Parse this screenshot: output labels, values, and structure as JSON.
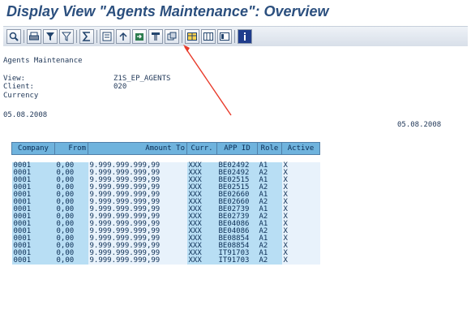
{
  "window_title": "Display View \"Agents Maintenance\": Overview",
  "toolbar": {
    "buttons": [
      "back-icon",
      "print-icon",
      "filter-icon",
      "filter-options-icon",
      "sum-icon",
      "details-icon",
      "sort-icon",
      "export-icon",
      "layout-icon",
      "graphic-icon",
      "grid-icon",
      "selection-icon",
      "columns-icon",
      "info-icon"
    ]
  },
  "header": {
    "heading": "Agents Maintenance",
    "view_label": "View:",
    "view_value": "Z1S_EP_AGENTS",
    "client_label": "Client:",
    "client_value": "020",
    "currency_label": "Currency",
    "date_left": "05.08.2008",
    "date_right": "05.08.2008"
  },
  "table": {
    "columns": [
      "Company",
      "From",
      "Amount To",
      "Curr.",
      "APP ID",
      "Role",
      "Active"
    ],
    "rows": [
      [
        "0001",
        "0,00",
        "9.999.999.999,99",
        "XXX",
        "BE02492",
        "A1",
        "X"
      ],
      [
        "0001",
        "0,00",
        "9.999.999.999,99",
        "XXX",
        "BE02492",
        "A2",
        "X"
      ],
      [
        "0001",
        "0,00",
        "9.999.999.999,99",
        "XXX",
        "BE02515",
        "A1",
        "X"
      ],
      [
        "0001",
        "0,00",
        "9.999.999.999,99",
        "XXX",
        "BE02515",
        "A2",
        "X"
      ],
      [
        "0001",
        "0,00",
        "9.999.999.999,99",
        "XXX",
        "BE02660",
        "A1",
        "X"
      ],
      [
        "0001",
        "0,00",
        "9.999.999.999,99",
        "XXX",
        "BE02660",
        "A2",
        "X"
      ],
      [
        "0001",
        "0,00",
        "9.999.999.999,99",
        "XXX",
        "BE02739",
        "A1",
        "X"
      ],
      [
        "0001",
        "0,00",
        "9.999.999.999,99",
        "XXX",
        "BE02739",
        "A2",
        "X"
      ],
      [
        "0001",
        "0,00",
        "9.999.999.999,99",
        "XXX",
        "BE04086",
        "A1",
        "X"
      ],
      [
        "0001",
        "0,00",
        "9.999.999.999,99",
        "XXX",
        "BE04086",
        "A2",
        "X"
      ],
      [
        "0001",
        "0,00",
        "9.999.999.999,99",
        "XXX",
        "BE08854",
        "A1",
        "X"
      ],
      [
        "0001",
        "0,00",
        "9.999.999.999,99",
        "XXX",
        "BE08854",
        "A2",
        "X"
      ],
      [
        "0001",
        "0,00",
        "9.999.999.999,99",
        "XXX",
        "IT91703",
        "A1",
        "X"
      ],
      [
        "0001",
        "0,00",
        "9.999.999.999,99",
        "XXX",
        "IT91703",
        "A2",
        "X"
      ]
    ]
  },
  "colors": {
    "header_bg": "#6fb3dd",
    "cell_bg": "#b8def4",
    "title": "#2b4f7e",
    "arrow": "#e83a2a"
  }
}
